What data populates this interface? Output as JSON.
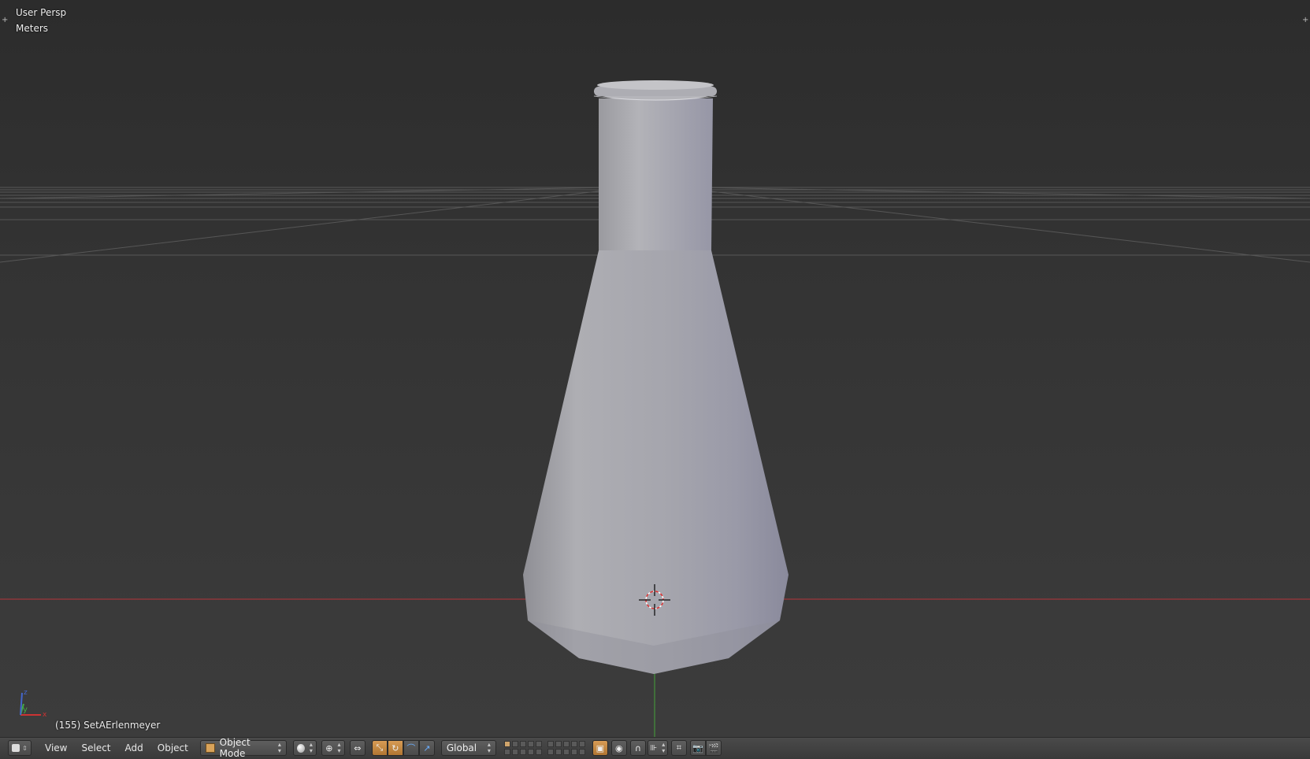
{
  "viewport": {
    "view_name": "User Persp",
    "units": "Meters",
    "object_info": "(155) SetAErlenmeyer",
    "object_color": "#b7b7c0",
    "axis_x_color": "#c0363a",
    "axis_y_color": "#46a23a",
    "grid_color": "#5a5a5a"
  },
  "header": {
    "menu": {
      "view": "View",
      "select": "Select",
      "add": "Add",
      "object": "Object"
    },
    "mode": "Object Mode",
    "orientation": "Global",
    "icons": {
      "editor_type": "3d-view-icon",
      "shading": "solid-sphere-icon",
      "pivot": "pivot-point-icon",
      "manipulator": "manipulator-icon",
      "translate": "translate-icon",
      "rotate": "rotate-icon",
      "scale": "scale-icon",
      "layer_lock": "layer-lock-icon",
      "proportional": "proportional-edit-icon",
      "snap": "snap-magnet-icon",
      "snap_target": "snap-target-icon",
      "render_opengl": "render-camera-icon",
      "render_anim": "render-animation-icon"
    },
    "layers_active": [
      0
    ]
  }
}
